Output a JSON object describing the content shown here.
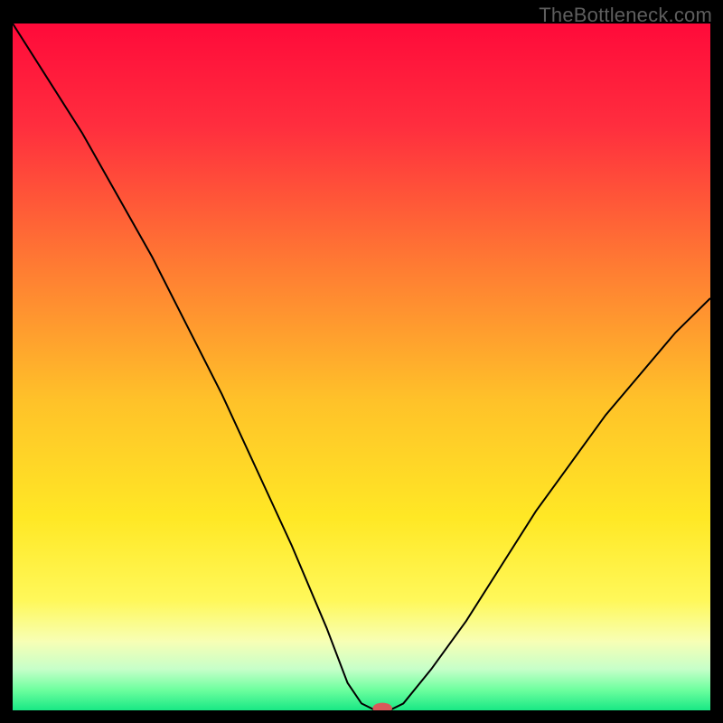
{
  "watermark": "TheBottleneck.com",
  "chart_data": {
    "type": "line",
    "title": "",
    "xlabel": "",
    "ylabel": "",
    "xlim": [
      0,
      100
    ],
    "ylim": [
      0,
      100
    ],
    "x": [
      0,
      5,
      10,
      15,
      20,
      25,
      30,
      35,
      40,
      45,
      48,
      50,
      52,
      54,
      56,
      60,
      65,
      70,
      75,
      80,
      85,
      90,
      95,
      100
    ],
    "values": [
      100,
      92,
      84,
      75,
      66,
      56,
      46,
      35,
      24,
      12,
      4,
      1,
      0,
      0,
      1,
      6,
      13,
      21,
      29,
      36,
      43,
      49,
      55,
      60
    ],
    "gradient_stops": [
      {
        "offset": 0.0,
        "color": "#ff0a3a"
      },
      {
        "offset": 0.15,
        "color": "#ff2e3e"
      },
      {
        "offset": 0.35,
        "color": "#ff7a33"
      },
      {
        "offset": 0.55,
        "color": "#ffc229"
      },
      {
        "offset": 0.72,
        "color": "#ffe825"
      },
      {
        "offset": 0.84,
        "color": "#fff85a"
      },
      {
        "offset": 0.9,
        "color": "#f7ffb5"
      },
      {
        "offset": 0.94,
        "color": "#c6ffc9"
      },
      {
        "offset": 0.97,
        "color": "#6eff9f"
      },
      {
        "offset": 1.0,
        "color": "#18e884"
      }
    ],
    "marker": {
      "x": 53.0,
      "y": 0.3,
      "rx": 1.4,
      "ry": 0.8,
      "color": "#d85a5a"
    }
  }
}
